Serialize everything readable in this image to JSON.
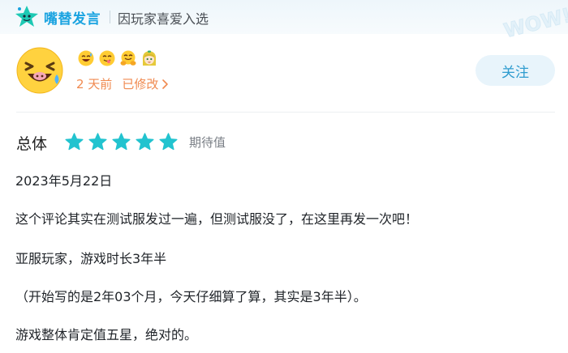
{
  "header": {
    "brand": "嘴替发言",
    "tagline": "因玩家喜爱入选",
    "logo_icon": "star-mascot-icon",
    "badge_icon": "wow-badge-icon"
  },
  "review": {
    "avatar_icon": "laughing-emoji-avatar-icon",
    "reactions": [
      "grinning-sweat-icon",
      "yum-face-icon",
      "hugging-face-icon",
      "girl-character-icon"
    ],
    "time": "2 天前",
    "edited": "已修改",
    "follow_label": "关注",
    "overall_label": "总体",
    "stars": 5,
    "rating_text": "期待值",
    "colors": {
      "star": "#22c3cf",
      "accent_orange": "#f08a50",
      "follow_bg": "#e8f4fb",
      "follow_text": "#2f9ccf",
      "brand_blue": "#1aa3e0"
    },
    "body": [
      "2023年5月22日",
      "这个评论其实在测试服发过一遍，但测试服没了，在这里再发一次吧！",
      "亚服玩家，游戏时长3年半",
      "（开始写的是2年03个月，今天仔细算了算，其实是3年半）。",
      "游戏整体肯定值五星，绝对的。"
    ]
  }
}
